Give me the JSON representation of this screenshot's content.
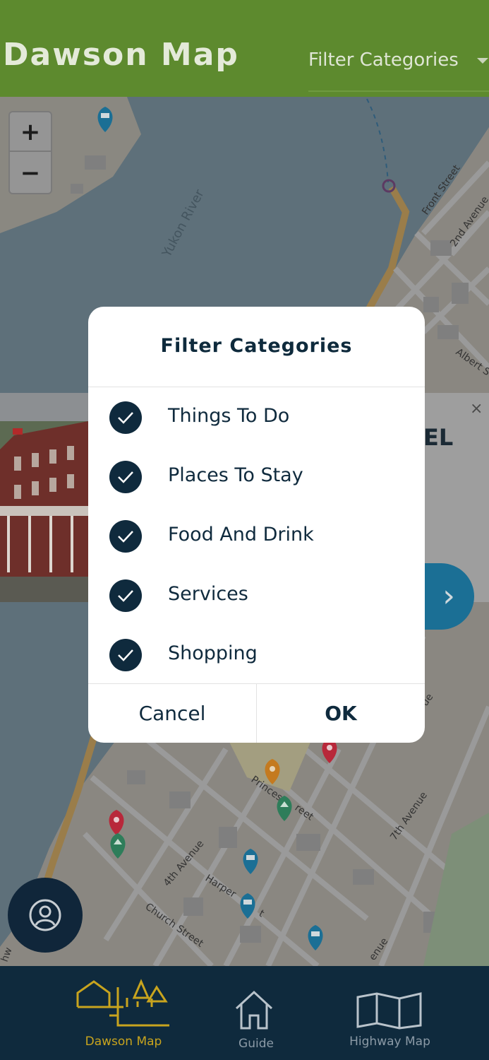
{
  "header": {
    "title": "Dawson Map",
    "filter_label": "Filter Categories"
  },
  "map": {
    "zoom_in": "+",
    "zoom_out": "−",
    "river_label": "Yukon River",
    "street_labels": {
      "front": "Front Street",
      "second": "2nd Avenue",
      "albert": "Albert S",
      "fourth": "4th Avenue",
      "harper": "Harper",
      "church": "Church Street",
      "princess": "Princes",
      "seventh": "7th Avenue",
      "reet": "reet",
      "ue": "ue",
      "enue": "enue",
      "hw": "hw",
      "t": "t"
    }
  },
  "card": {
    "title_fragment": "EL",
    "close": "×",
    "next": "›"
  },
  "dialog": {
    "title": "Filter Categories",
    "options": [
      {
        "label": "Things To Do",
        "checked": true
      },
      {
        "label": "Places To Stay",
        "checked": true
      },
      {
        "label": "Food And Drink",
        "checked": true
      },
      {
        "label": "Services",
        "checked": true
      },
      {
        "label": "Shopping",
        "checked": true
      }
    ],
    "cancel": "Cancel",
    "ok": "OK"
  },
  "tabbar": {
    "tabs": [
      {
        "label": "Dawson Map",
        "active": true
      },
      {
        "label": "Guide",
        "active": false
      },
      {
        "label": "Highway Map",
        "active": false
      }
    ]
  },
  "colors": {
    "header": "#5d8a2e",
    "navy": "#0f2a3d",
    "active_tab": "#c8a41e",
    "pin_blue": "#1b6f95",
    "pin_red": "#b8283a",
    "pin_green": "#2e7d5a",
    "pin_orange": "#c47a1f"
  }
}
